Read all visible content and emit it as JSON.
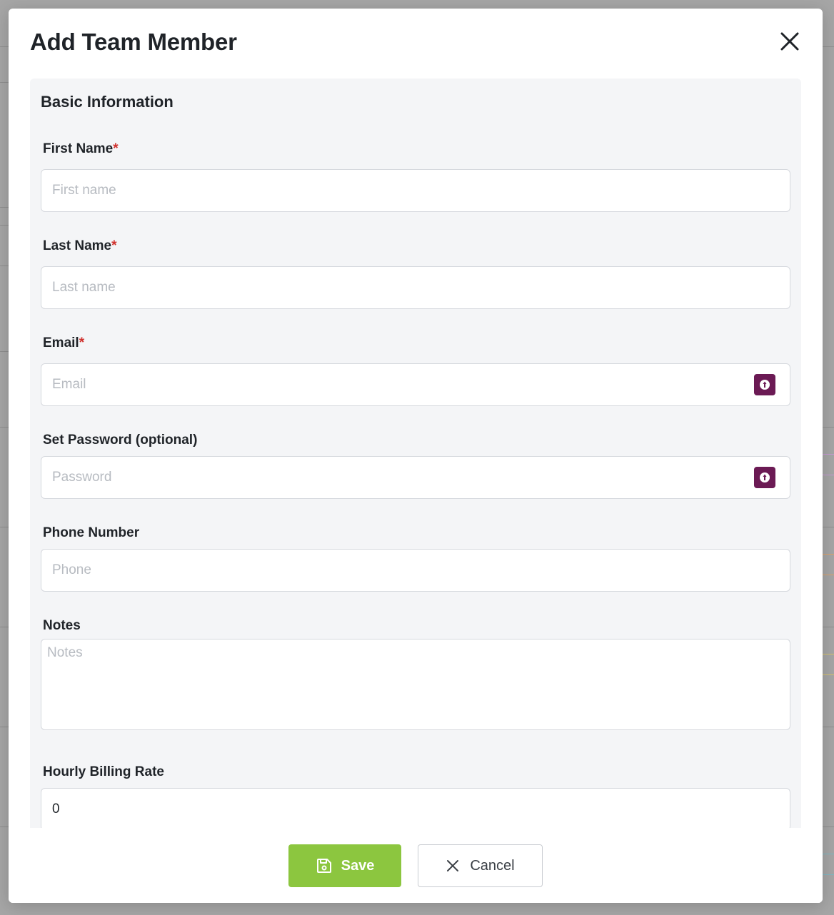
{
  "modal": {
    "title": "Add Team Member"
  },
  "section": {
    "title": "Basic Information"
  },
  "fields": {
    "first_name": {
      "label": "First Name",
      "required_mark": "*",
      "placeholder": "First name",
      "value": ""
    },
    "last_name": {
      "label": "Last Name",
      "required_mark": "*",
      "placeholder": "Last name",
      "value": ""
    },
    "email": {
      "label": "Email",
      "required_mark": "*",
      "placeholder": "Email",
      "value": ""
    },
    "password": {
      "label": "Set Password (optional)",
      "placeholder": "Password",
      "value": ""
    },
    "phone": {
      "label": "Phone Number",
      "placeholder": "Phone",
      "value": ""
    },
    "notes": {
      "label": "Notes",
      "placeholder": "Notes",
      "value": ""
    },
    "hourly_rate": {
      "label": "Hourly Billing Rate",
      "placeholder": "",
      "value": "0"
    }
  },
  "footer": {
    "save_label": "Save",
    "cancel_label": "Cancel"
  },
  "colors": {
    "save_button": "#8cc63f",
    "password_manager_badge": "#6b1a54",
    "required_asterisk": "#d0312d"
  },
  "icons": {
    "close": "close-icon",
    "password_manager": "password-manager-icon",
    "save": "save-icon",
    "cancel": "x-icon"
  }
}
